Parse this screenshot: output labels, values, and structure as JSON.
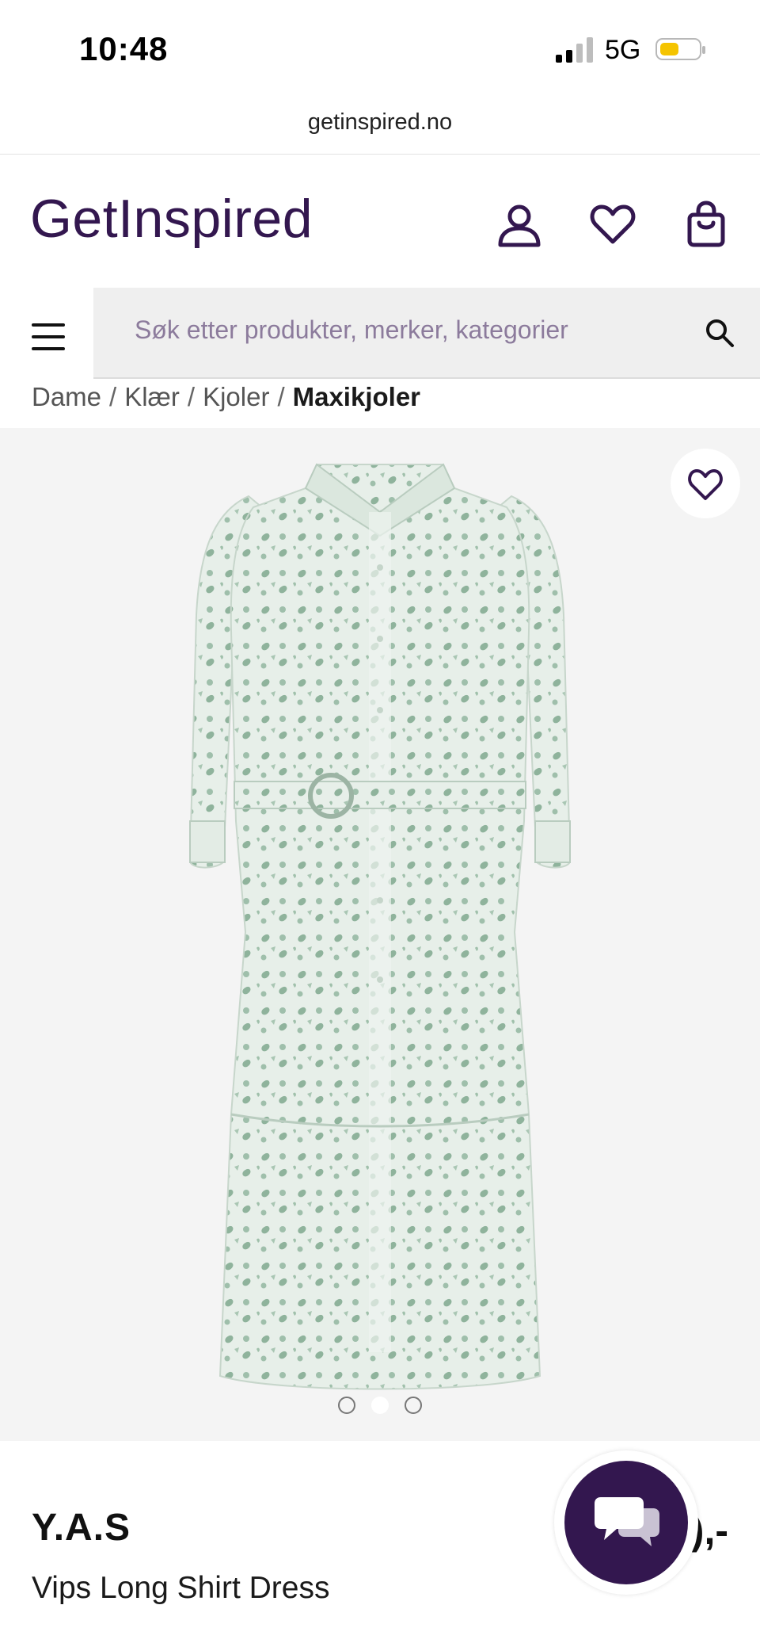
{
  "status_bar": {
    "time": "10:48",
    "network": "5G",
    "battery_level": 0.45,
    "battery_color": "#f5c400"
  },
  "browser": {
    "url": "getinspired.no"
  },
  "header": {
    "logo": "GetInspired",
    "brand_color": "#33174f",
    "icons": [
      "user-icon",
      "heart-icon",
      "shopping-bag-icon"
    ]
  },
  "search": {
    "placeholder": "Søk etter produkter, merker, kategorier",
    "value": "",
    "menu_icon": "hamburger-menu-icon",
    "search_icon": "magnifier-icon"
  },
  "breadcrumb": {
    "items": [
      "Dame",
      "Klær",
      "Kjoler"
    ],
    "separator": "/",
    "current": "Maxikjoler"
  },
  "gallery": {
    "image_description_icon": "product-image",
    "wishlist_icon": "heart-outline-icon",
    "slide_count": 3,
    "active_slide": 2
  },
  "product": {
    "brand": "Y.A.S",
    "name": "Vips Long Shirt Dress",
    "price_visible": "),-"
  },
  "chat": {
    "icon": "chat-bubbles-icon",
    "color": "#33174f"
  }
}
